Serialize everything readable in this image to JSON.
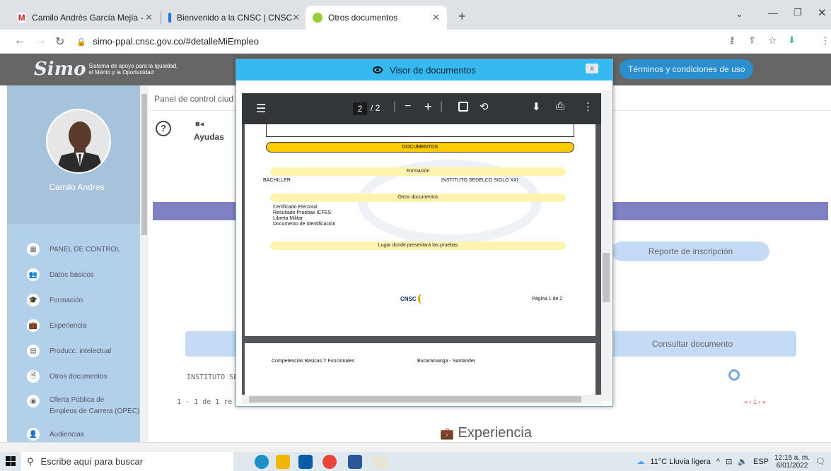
{
  "browser": {
    "tabs": [
      {
        "label": "Camilo Andrés García Mejía - ava",
        "color": "#c5221f"
      },
      {
        "label": "Bienvenido a la CNSC | CNSC",
        "color": "#1a73e8"
      },
      {
        "label": "Otros documentos",
        "color": "#9acd32"
      }
    ],
    "url": "simo-ppal.cnsc.gov.co/#detalleMiEmpleo"
  },
  "app": {
    "logo_big": "Simo",
    "logo_line1": "Sistema de apoyo para la Igualdad,",
    "logo_line2": "el Mérito y la Oportunidad",
    "terms_button": "Términos y condiciones de uso",
    "user_name": "Camilo Andres",
    "sidebar": [
      {
        "label": "PANEL DE CONTROL",
        "icon": "grid-icon"
      },
      {
        "label": "Datos básicos",
        "icon": "people-icon"
      },
      {
        "label": "Formación",
        "icon": "graduate-icon"
      },
      {
        "label": "Experiencia",
        "icon": "briefcase-icon"
      },
      {
        "label": "Producc. intelectual",
        "icon": "book-icon"
      },
      {
        "label": "Otros documentos",
        "icon": "document-icon"
      },
      {
        "label": "Oferta Pública de",
        "label2": "Empleos de Carrera (OPEC)",
        "icon": "globe-icon"
      },
      {
        "label": "Audiencias",
        "icon": "audience-icon"
      }
    ],
    "breadcrumb": "Panel de control ciud",
    "help_label": "Ayudas",
    "report_button": "Reporte de inscripción",
    "consult_button": "Consultar documento",
    "institute_text": "INSTITUTO SE",
    "pager_text": "1 - 1 de 1 re",
    "pagination": "« ‹ 1 › »",
    "section_title": "Experiencia"
  },
  "modal": {
    "title": "Visor de documentos",
    "close": "x",
    "pdf": {
      "page_current": "2",
      "page_total": "/ 2",
      "documents_header": "DOCUMENTOS",
      "formacion_header": "Formación",
      "degree": "BACHILLER",
      "institution": "INSTITUTO SEDELCO SIGLO XXI",
      "otros_header": "Otros documentos",
      "otros_items": [
        "Certificado Electoral",
        "Resultado Pruebas ICFES",
        "Libreta Militar",
        "Documento de Identificación"
      ],
      "lugar_header": "Lugar donde presentará las pruebas",
      "cnsc_logo": "CNSC",
      "page_label": "Página 1 de 2",
      "page2_left": "Competencias Basicas Y Funcionales",
      "page2_right": "Bucaramanga - Santander"
    }
  },
  "taskbar": {
    "search_placeholder": "Escribe aquí para buscar",
    "weather": "11°C  Lluvia ligera",
    "lang": "ESP",
    "time": "12:15 a. m.",
    "date": "6/01/2022"
  }
}
